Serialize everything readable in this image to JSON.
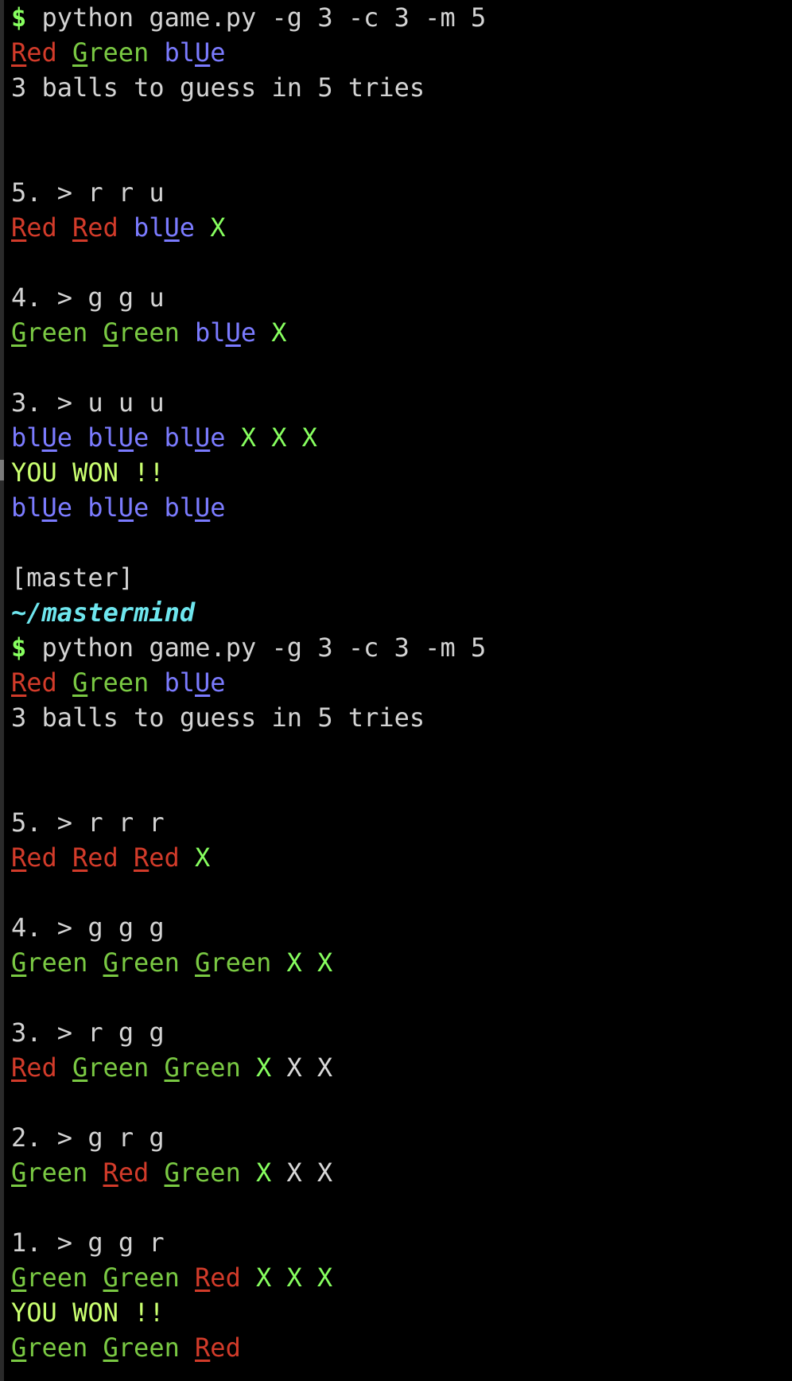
{
  "colors": {
    "red": "#d23b2a",
    "green": "#7ac943",
    "blue": "#7b7bff",
    "mark": "#87ff5f",
    "white_mark": "#d9d9d9",
    "text": "#d3d3d3",
    "won": "#caff70",
    "path": "#6ee6ee",
    "prompt": "#87ff5f"
  },
  "lines": [
    {
      "type": "cmd",
      "prompt": "$",
      "cmd": "python game.py -g 3 -c 3 -m 5"
    },
    {
      "type": "balls",
      "items": [
        {
          "c": "red",
          "pre": "",
          "u": "R",
          "post": "ed"
        },
        {
          "c": "green",
          "pre": "",
          "u": "G",
          "post": "reen"
        },
        {
          "c": "blue",
          "pre": "bl",
          "u": "U",
          "post": "e"
        }
      ]
    },
    {
      "type": "text",
      "text": "3 balls to guess in 5 tries"
    },
    {
      "type": "blank"
    },
    {
      "type": "blank"
    },
    {
      "type": "text",
      "text": "5. > r r u"
    },
    {
      "type": "balls",
      "items": [
        {
          "c": "red",
          "pre": "",
          "u": "R",
          "post": "ed"
        },
        {
          "c": "red",
          "pre": "",
          "u": "R",
          "post": "ed"
        },
        {
          "c": "blue",
          "pre": "bl",
          "u": "U",
          "post": "e"
        }
      ],
      "marks": [
        {
          "c": "mark",
          "t": "X"
        }
      ]
    },
    {
      "type": "blank"
    },
    {
      "type": "text",
      "text": "4. > g g u"
    },
    {
      "type": "balls",
      "items": [
        {
          "c": "green",
          "pre": "",
          "u": "G",
          "post": "reen"
        },
        {
          "c": "green",
          "pre": "",
          "u": "G",
          "post": "reen"
        },
        {
          "c": "blue",
          "pre": "bl",
          "u": "U",
          "post": "e"
        }
      ],
      "marks": [
        {
          "c": "mark",
          "t": "X"
        }
      ]
    },
    {
      "type": "blank"
    },
    {
      "type": "text",
      "text": "3. > u u u"
    },
    {
      "type": "balls",
      "items": [
        {
          "c": "blue",
          "pre": "bl",
          "u": "U",
          "post": "e"
        },
        {
          "c": "blue",
          "pre": "bl",
          "u": "U",
          "post": "e"
        },
        {
          "c": "blue",
          "pre": "bl",
          "u": "U",
          "post": "e"
        }
      ],
      "marks": [
        {
          "c": "mark",
          "t": "X"
        },
        {
          "c": "mark",
          "t": "X"
        },
        {
          "c": "mark",
          "t": "X"
        }
      ]
    },
    {
      "type": "won",
      "text": "YOU WON !!"
    },
    {
      "type": "balls",
      "items": [
        {
          "c": "blue",
          "pre": "bl",
          "u": "U",
          "post": "e"
        },
        {
          "c": "blue",
          "pre": "bl",
          "u": "U",
          "post": "e"
        },
        {
          "c": "blue",
          "pre": "bl",
          "u": "U",
          "post": "e"
        }
      ]
    },
    {
      "type": "blank"
    },
    {
      "type": "text",
      "text": "[master]"
    },
    {
      "type": "path",
      "text": "~/mastermind"
    },
    {
      "type": "cmd",
      "prompt": "$",
      "cmd": "python game.py -g 3 -c 3 -m 5"
    },
    {
      "type": "balls",
      "items": [
        {
          "c": "red",
          "pre": "",
          "u": "R",
          "post": "ed"
        },
        {
          "c": "green",
          "pre": "",
          "u": "G",
          "post": "reen"
        },
        {
          "c": "blue",
          "pre": "bl",
          "u": "U",
          "post": "e"
        }
      ]
    },
    {
      "type": "text",
      "text": "3 balls to guess in 5 tries"
    },
    {
      "type": "blank"
    },
    {
      "type": "blank"
    },
    {
      "type": "text",
      "text": "5. > r r r"
    },
    {
      "type": "balls",
      "items": [
        {
          "c": "red",
          "pre": "",
          "u": "R",
          "post": "ed"
        },
        {
          "c": "red",
          "pre": "",
          "u": "R",
          "post": "ed"
        },
        {
          "c": "red",
          "pre": "",
          "u": "R",
          "post": "ed"
        }
      ],
      "marks": [
        {
          "c": "mark",
          "t": "X"
        }
      ]
    },
    {
      "type": "blank"
    },
    {
      "type": "text",
      "text": "4. > g g g"
    },
    {
      "type": "balls",
      "items": [
        {
          "c": "green",
          "pre": "",
          "u": "G",
          "post": "reen"
        },
        {
          "c": "green",
          "pre": "",
          "u": "G",
          "post": "reen"
        },
        {
          "c": "green",
          "pre": "",
          "u": "G",
          "post": "reen"
        }
      ],
      "marks": [
        {
          "c": "mark",
          "t": "X"
        },
        {
          "c": "mark",
          "t": "X"
        }
      ]
    },
    {
      "type": "blank"
    },
    {
      "type": "text",
      "text": "3. > r g g"
    },
    {
      "type": "balls",
      "items": [
        {
          "c": "red",
          "pre": "",
          "u": "R",
          "post": "ed"
        },
        {
          "c": "green",
          "pre": "",
          "u": "G",
          "post": "reen"
        },
        {
          "c": "green",
          "pre": "",
          "u": "G",
          "post": "reen"
        }
      ],
      "marks": [
        {
          "c": "mark",
          "t": "X"
        },
        {
          "c": "white_mark",
          "t": "X"
        },
        {
          "c": "white_mark",
          "t": "X"
        }
      ]
    },
    {
      "type": "blank"
    },
    {
      "type": "text",
      "text": "2. > g r g"
    },
    {
      "type": "balls",
      "items": [
        {
          "c": "green",
          "pre": "",
          "u": "G",
          "post": "reen"
        },
        {
          "c": "red",
          "pre": "",
          "u": "R",
          "post": "ed"
        },
        {
          "c": "green",
          "pre": "",
          "u": "G",
          "post": "reen"
        }
      ],
      "marks": [
        {
          "c": "mark",
          "t": "X"
        },
        {
          "c": "white_mark",
          "t": "X"
        },
        {
          "c": "white_mark",
          "t": "X"
        }
      ]
    },
    {
      "type": "blank"
    },
    {
      "type": "text",
      "text": "1. > g g r"
    },
    {
      "type": "balls",
      "items": [
        {
          "c": "green",
          "pre": "",
          "u": "G",
          "post": "reen"
        },
        {
          "c": "green",
          "pre": "",
          "u": "G",
          "post": "reen"
        },
        {
          "c": "red",
          "pre": "",
          "u": "R",
          "post": "ed"
        }
      ],
      "marks": [
        {
          "c": "mark",
          "t": "X"
        },
        {
          "c": "mark",
          "t": "X"
        },
        {
          "c": "mark",
          "t": "X"
        }
      ]
    },
    {
      "type": "won",
      "text": "YOU WON !!"
    },
    {
      "type": "balls",
      "items": [
        {
          "c": "green",
          "pre": "",
          "u": "G",
          "post": "reen"
        },
        {
          "c": "green",
          "pre": "",
          "u": "G",
          "post": "reen"
        },
        {
          "c": "red",
          "pre": "",
          "u": "R",
          "post": "ed"
        }
      ]
    }
  ]
}
